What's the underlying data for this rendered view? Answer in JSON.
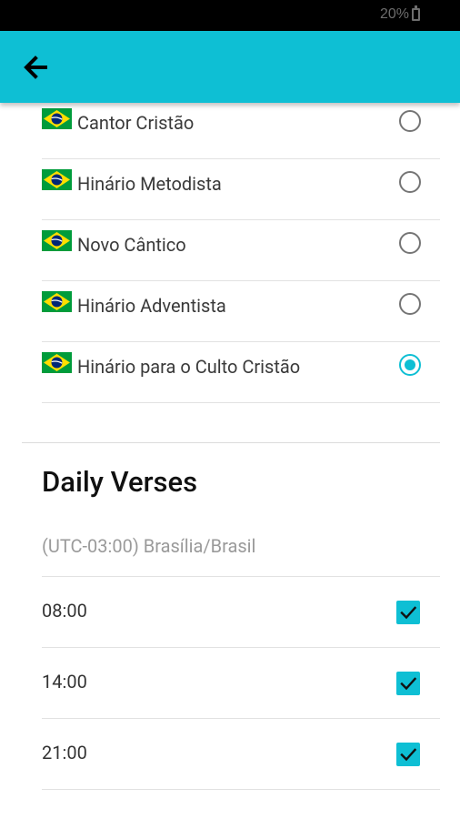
{
  "status_bar": {
    "battery": "20%"
  },
  "app_bar": {
    "back_icon": "arrow-left-icon"
  },
  "hymnals": [
    {
      "label": "Cantor Cristão",
      "selected": false
    },
    {
      "label": "Hinário Metodista",
      "selected": false
    },
    {
      "label": "Novo Cântico",
      "selected": false
    },
    {
      "label": "Hinário Adventista",
      "selected": false
    },
    {
      "label": "Hinário para o Culto Cristão",
      "selected": true
    }
  ],
  "daily_verses": {
    "title": "Daily Verses",
    "timezone": "(UTC-03:00) Brasília/Brasil",
    "times": [
      {
        "time": "08:00",
        "checked": true
      },
      {
        "time": "14:00",
        "checked": true
      },
      {
        "time": "21:00",
        "checked": true
      }
    ]
  },
  "colors": {
    "accent": "#0ebfd4",
    "flag_green": "#009c3b",
    "flag_yellow": "#ffdf00",
    "flag_blue": "#002776"
  }
}
